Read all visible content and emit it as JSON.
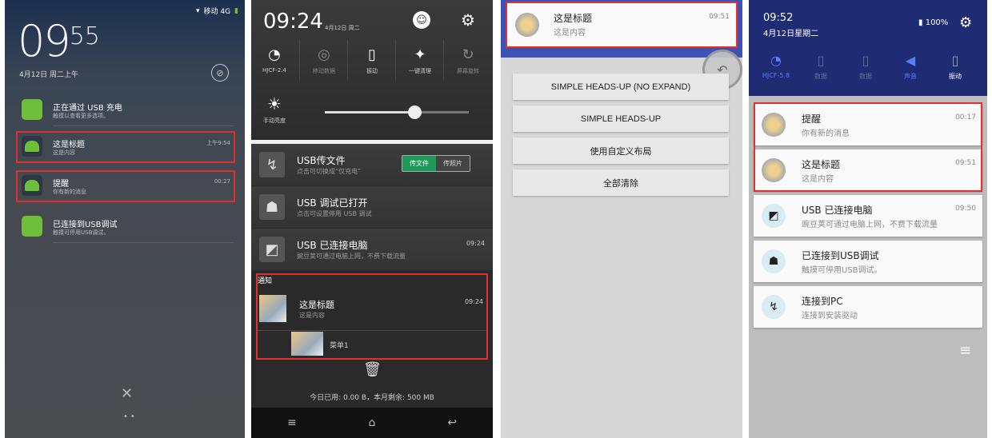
{
  "panel1": {
    "status": {
      "signal": "移动 4G"
    },
    "clock_hour": "09",
    "clock_min": "55",
    "date": "4月12日 周二上午",
    "notifications": [
      {
        "title": "正在通过 USB 充电",
        "subtitle": "触摸以查看更多选项。",
        "time": ""
      },
      {
        "title": "这是标题",
        "subtitle": "这是内容",
        "time": "上午9:54"
      },
      {
        "title": "提醒",
        "subtitle": "你有新的消息",
        "time": "00:27"
      },
      {
        "title": "已连接到USB调试",
        "subtitle": "触摸可停用USB调试。",
        "time": ""
      }
    ]
  },
  "panel2": {
    "time": "09:24",
    "date": "4月12日 周二",
    "tiles": [
      {
        "label": "HJCF-2.4",
        "icon": "wifi-icon"
      },
      {
        "label": "移动数据",
        "icon": "globe-icon"
      },
      {
        "label": "振动",
        "icon": "vibrate-icon"
      },
      {
        "label": "一键清理",
        "icon": "broom-icon"
      },
      {
        "label": "屏幕旋转",
        "icon": "rotate-icon"
      }
    ],
    "brightness_label": "手动亮度",
    "brightness_level": 0.62,
    "notifications": [
      {
        "title": "USB传文件",
        "subtitle": "点击可切换成“仅充电”",
        "time": "",
        "seg": [
          "传文件",
          "传照片"
        ]
      },
      {
        "title": "USB 调试已打开",
        "subtitle": "点击可设置停用 USB 调试",
        "time": ""
      },
      {
        "title": "USB 已连接电脑",
        "subtitle": "豌豆荚可通过电脑上网，不费下载流量",
        "time": "09:24"
      }
    ],
    "section_label": "通知",
    "custom_notif": {
      "title": "这是标题",
      "subtitle": "这是内容",
      "time": "09:24",
      "menu": "菜单1"
    },
    "usage": "今日已用: 0.00 B，本月剩余: 500 MB"
  },
  "panel3": {
    "heads_up": {
      "title": "这是标题",
      "subtitle": "这是内容",
      "time": "09:51"
    },
    "buttons": [
      "SIMPLE HEADS-UP (NO EXPAND)",
      "SIMPLE HEADS-UP",
      "使用自定义布局",
      "全部清除"
    ]
  },
  "panel4": {
    "time": "09:52",
    "date": "4月12日星期二",
    "battery": "100%",
    "tiles": [
      {
        "label": "HJCF-5.8",
        "icon": "wifi-icon",
        "active": true
      },
      {
        "label": "数据",
        "icon": "sim1-icon",
        "active": false
      },
      {
        "label": "数据",
        "icon": "sim2-icon",
        "active": false
      },
      {
        "label": "声音",
        "icon": "volume-icon",
        "active": true
      },
      {
        "label": "振动",
        "icon": "vibrate-icon",
        "active": false
      }
    ],
    "notifications": [
      {
        "title": "提醒",
        "subtitle": "你有新的消息",
        "time": "00:17"
      },
      {
        "title": "这是标题",
        "subtitle": "这是内容",
        "time": "09:51"
      },
      {
        "title": "USB 已连接电脑",
        "subtitle": "豌豆荚可通过电脑上网，不费下载流量",
        "time": "09:50"
      },
      {
        "title": "已连接到USB调试",
        "subtitle": "触摸可停用USB调试。",
        "time": ""
      },
      {
        "title": "连接到PC",
        "subtitle": "连接到安装驱动",
        "time": ""
      }
    ]
  },
  "colors": {
    "highlight": "#e03030",
    "accent_green": "#1e9a59",
    "appbar": "#3f51b5",
    "p4_top": "#1f2c74",
    "active_tile": "#5a7cff"
  }
}
